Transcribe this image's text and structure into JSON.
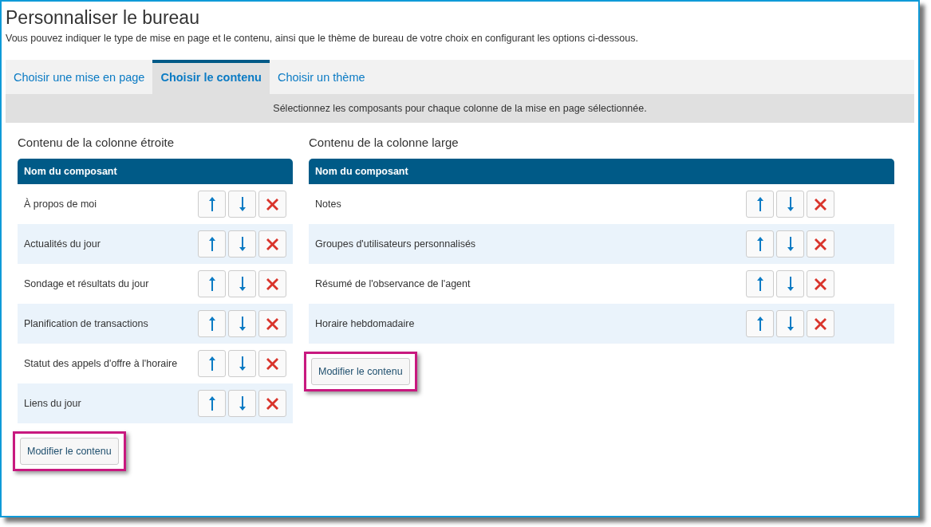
{
  "title": "Personnaliser le bureau",
  "subtitle": "Vous pouvez indiquer le type de mise en page et le contenu, ainsi que le thème de bureau de votre choix en configurant les options ci-dessous.",
  "tabs": [
    {
      "label": "Choisir une mise en page",
      "selected": false
    },
    {
      "label": "Choisir le contenu",
      "selected": true
    },
    {
      "label": "Choisir un thème",
      "selected": false
    }
  ],
  "instruction": "Sélectionnez les composants pour chaque colonne de la mise en page sélectionnée.",
  "columns": [
    {
      "heading": "Contenu de la colonne étroite",
      "table_header": "Nom du composant",
      "rows": [
        "À propos de moi",
        "Actualités du jour",
        "Sondage et résultats du jour",
        "Planification de transactions",
        "Statut des appels d'offre à l'horaire",
        "Liens du jour"
      ],
      "button": "Modifier le contenu",
      "highlighted": true
    },
    {
      "heading": "Contenu de la colonne large",
      "table_header": "Nom du composant",
      "rows": [
        "Notes",
        "Groupes d'utilisateurs personnalisés",
        "Résumé de l'observance de l'agent",
        "Horaire hebdomadaire"
      ],
      "button": "Modifier le contenu",
      "highlighted": true
    }
  ]
}
